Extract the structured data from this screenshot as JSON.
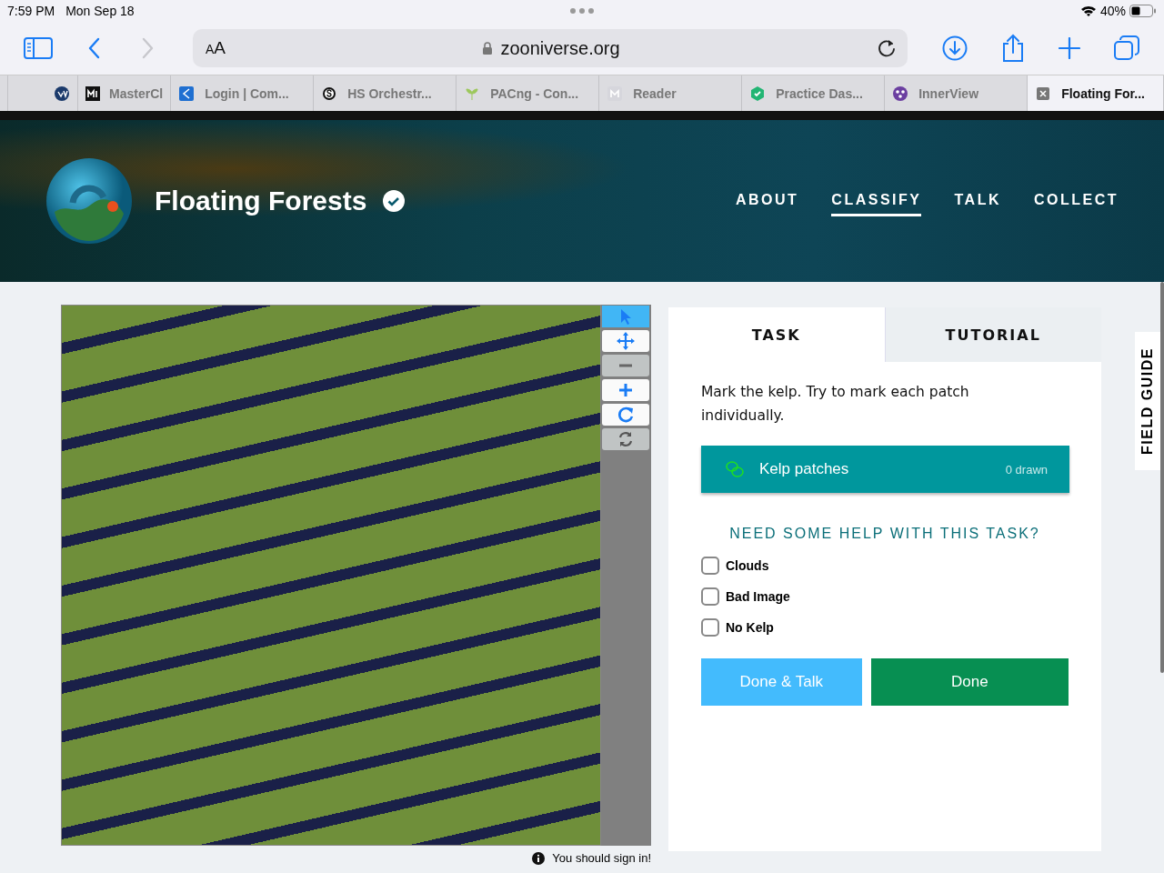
{
  "status_bar": {
    "time": "7:59 PM",
    "date": "Mon Sep 18",
    "battery": "40%"
  },
  "toolbar": {
    "text_size_label": "AA",
    "url": "zooniverse.org"
  },
  "browser_tabs": [
    {
      "kind": "cv",
      "selected": false
    },
    {
      "title": "MasterCl",
      "kind": "mdark",
      "selected": false
    },
    {
      "title": "Login | Com...",
      "kind": "blue",
      "selected": false
    },
    {
      "title": "HS Orchestr...",
      "kind": "scircle",
      "selected": false
    },
    {
      "title": "PACng - Con...",
      "kind": "leaf",
      "selected": false
    },
    {
      "title": "Reader",
      "kind": "mlight",
      "selected": false
    },
    {
      "title": "Practice Das...",
      "kind": "hex",
      "selected": false
    },
    {
      "title": "InnerView",
      "kind": "dots",
      "selected": false
    },
    {
      "title": "Floating For...",
      "kind": "close",
      "selected": true
    }
  ],
  "project": {
    "title": "Floating Forests",
    "verified": true,
    "nav": [
      {
        "label": "ABOUT",
        "selected": false
      },
      {
        "label": "CLASSIFY",
        "selected": true
      },
      {
        "label": "TALK",
        "selected": false
      },
      {
        "label": "COLLECT",
        "selected": false
      }
    ]
  },
  "image_tools": [
    {
      "kind": "pointer",
      "selected": true,
      "disabled": false
    },
    {
      "kind": "move",
      "selected": false,
      "disabled": false
    },
    {
      "kind": "zoom-out",
      "selected": false,
      "disabled": true
    },
    {
      "kind": "zoom-in",
      "selected": false,
      "disabled": false
    },
    {
      "kind": "rotate",
      "selected": false,
      "disabled": false
    },
    {
      "kind": "reset",
      "selected": false,
      "disabled": true
    }
  ],
  "sign_in_notice": "You should sign in!",
  "task_panel": {
    "tabs": [
      {
        "label": "TASK",
        "selected": true
      },
      {
        "label": "TUTORIAL",
        "selected": false
      }
    ],
    "instruction": "Mark the kelp. Try to mark each patch individually.",
    "tools": [
      {
        "label": "Kelp patches",
        "count": "0 drawn",
        "selected": true
      }
    ],
    "help_link": "NEED SOME HELP WITH THIS TASK?",
    "options": [
      {
        "label": "Clouds",
        "checked": false
      },
      {
        "label": "Bad Image",
        "checked": false
      },
      {
        "label": "No Kelp",
        "checked": false
      }
    ],
    "buttons": [
      {
        "label": "Done & Talk",
        "kind": "secondary"
      },
      {
        "label": "Done",
        "kind": "primary"
      }
    ]
  },
  "field_guide": {
    "label": "FIELD GUIDE"
  }
}
